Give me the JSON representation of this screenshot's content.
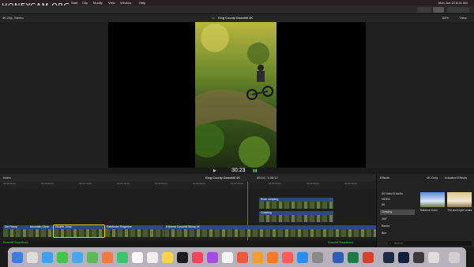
{
  "watermark": "HONEYCAM.ORG",
  "menubar": {
    "items": [
      "Start",
      "Clip",
      "Modify",
      "View",
      "Window",
      "Help"
    ],
    "clock": "Mon Jun 22 8:41 AM"
  },
  "viewer": {
    "left_label": "4K 24p, Stereo",
    "title": "King County Downhill 4K",
    "zoom": "84%",
    "view": "View"
  },
  "transport": {
    "timecode": "30:23"
  },
  "timeline": {
    "index_label": "Index",
    "project": "King County Downhill 4K",
    "position": "05:24 / 1:06:12",
    "ruler": [
      "00:00:00:00",
      "00:00:05:00",
      "00:00:10:00",
      "00:00:15:00",
      "00:00:20:00",
      "00:00:25:00",
      "00:00:30:00",
      "00:00:35:00",
      "00:00:40:00",
      "00:00:45:00"
    ],
    "connected_clips": [
      "Rock Jumping",
      "Coasting"
    ],
    "main_clips": [
      "Dirt Ramp",
      "Mountain Climb",
      "Double Jump",
      "Pathfinder Ridgeline",
      "Extreme Downhill Biking 4K"
    ],
    "footer_left": "Downhill Soundtrack",
    "footer_mid": "Downhill Soundtrack"
  },
  "effects": {
    "title": "Effects",
    "filter_4k": "4K Only",
    "installed": "Installed Effects",
    "categories": [
      "All Video & Audio",
      "VIDEO",
      "All",
      "Jumping",
      "360°",
      "Basics",
      "Blur"
    ],
    "selected_index": 3,
    "thumbs": [
      "Balance Color",
      "Tint and Light Leaks"
    ],
    "search_placeholder": "Search"
  }
}
